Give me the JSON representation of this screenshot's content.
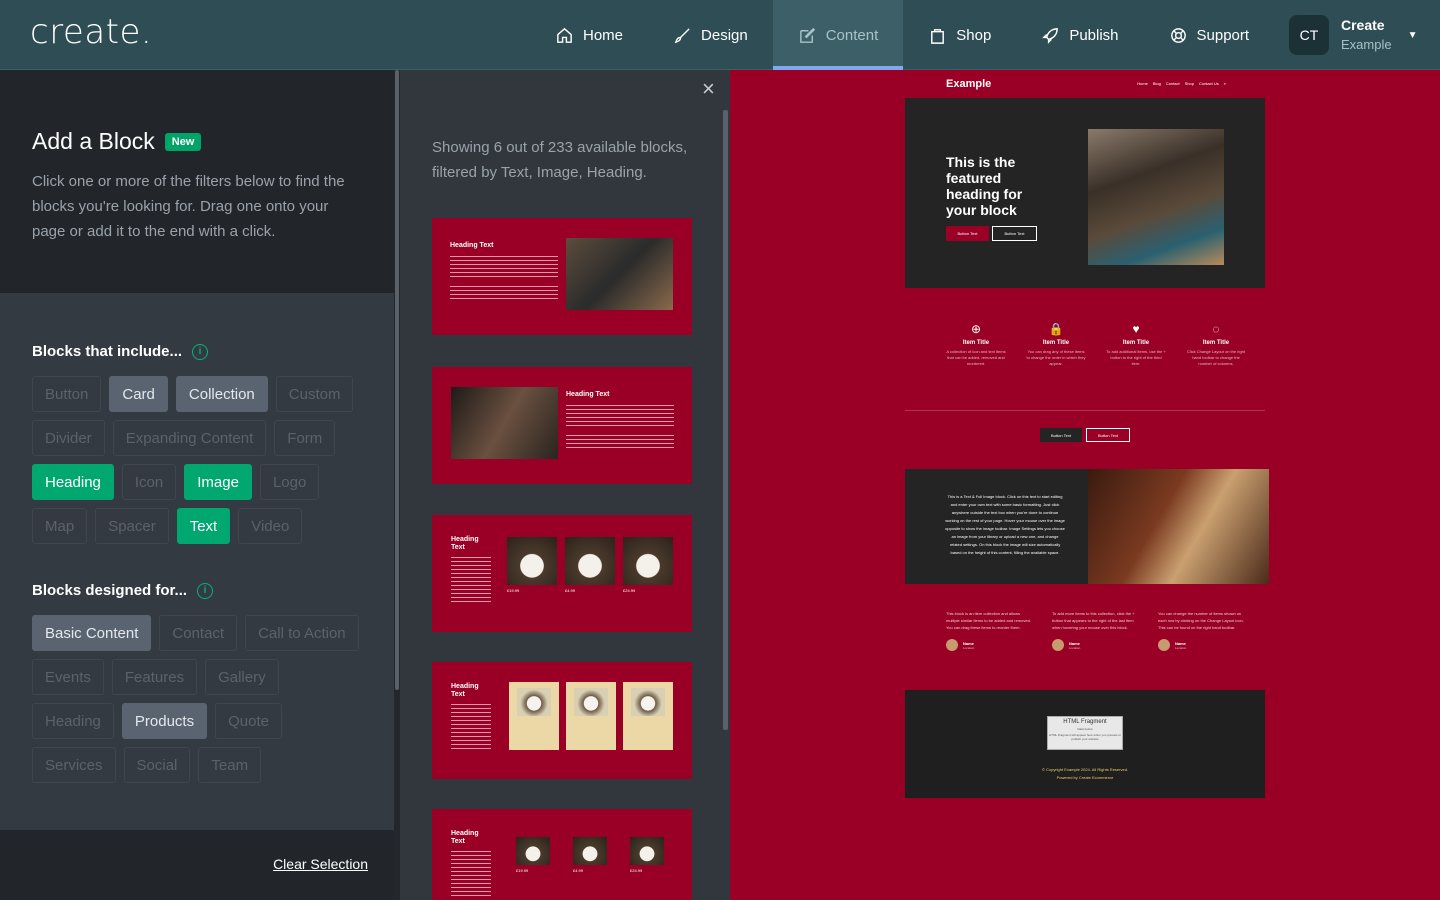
{
  "app": {
    "logo": "create."
  },
  "nav": [
    {
      "label": "Home",
      "icon": "home-icon"
    },
    {
      "label": "Design",
      "icon": "brush-icon"
    },
    {
      "label": "Content",
      "icon": "edit-icon",
      "active": true
    },
    {
      "label": "Shop",
      "icon": "shopping-bag-icon"
    },
    {
      "label": "Publish",
      "icon": "rocket-icon"
    },
    {
      "label": "Support",
      "icon": "lifebuoy-icon"
    }
  ],
  "user": {
    "initials": "CT",
    "name": "Create",
    "site": "Example"
  },
  "panel": {
    "title": "Add a Block",
    "badge": "New",
    "description": "Click one or more of the filters below to find the blocks you're looking for. Drag one onto your page or add it to the end with a click.",
    "include_title": "Blocks that include...",
    "include_chips": [
      {
        "label": "Button",
        "state": "disabled"
      },
      {
        "label": "Card",
        "state": "available"
      },
      {
        "label": "Collection",
        "state": "available"
      },
      {
        "label": "Custom",
        "state": "disabled"
      },
      {
        "label": "Divider",
        "state": "disabled"
      },
      {
        "label": "Expanding Content",
        "state": "disabled"
      },
      {
        "label": "Form",
        "state": "disabled"
      },
      {
        "label": "Heading",
        "state": "selected"
      },
      {
        "label": "Icon",
        "state": "disabled"
      },
      {
        "label": "Image",
        "state": "selected"
      },
      {
        "label": "Logo",
        "state": "disabled"
      },
      {
        "label": "Map",
        "state": "disabled"
      },
      {
        "label": "Spacer",
        "state": "disabled"
      },
      {
        "label": "Text",
        "state": "selected"
      },
      {
        "label": "Video",
        "state": "disabled"
      }
    ],
    "designed_title": "Blocks designed for...",
    "designed_chips": [
      {
        "label": "Basic Content",
        "state": "available"
      },
      {
        "label": "Contact",
        "state": "disabled"
      },
      {
        "label": "Call to Action",
        "state": "disabled"
      },
      {
        "label": "Events",
        "state": "disabled"
      },
      {
        "label": "Features",
        "state": "disabled"
      },
      {
        "label": "Gallery",
        "state": "disabled"
      },
      {
        "label": "Heading",
        "state": "disabled"
      },
      {
        "label": "Products",
        "state": "available"
      },
      {
        "label": "Quote",
        "state": "disabled"
      },
      {
        "label": "Services",
        "state": "disabled"
      },
      {
        "label": "Social",
        "state": "disabled"
      },
      {
        "label": "Team",
        "state": "disabled"
      }
    ],
    "clear_label": "Clear Selection"
  },
  "results": {
    "close_glyph": "×",
    "summary": "Showing 6 out of 233 available blocks, filtered by Text, Image, Heading.",
    "card_heading": "Heading Text",
    "card_heading_short": "Heading Text",
    "product_title": "Product Title",
    "prices": [
      "£19.99",
      "£4.99",
      "£24.99"
    ]
  },
  "preview": {
    "site_name": "Example",
    "links": [
      "Home",
      "Blog",
      "Contact",
      "Shop",
      "Contact Us"
    ],
    "hero_title": "This is the featured heading for your block",
    "button_text": "Button Text",
    "features": [
      {
        "icon": "zoom-icon",
        "glyph": "⊕",
        "title": "Item Title",
        "desc": "A collection of icon and text items that can be added, removed and reordered."
      },
      {
        "icon": "lock-icon",
        "glyph": "🔒",
        "title": "Item Title",
        "desc": "You can drag any of these items to change the order in which they appear."
      },
      {
        "icon": "heart-icon",
        "glyph": "♥",
        "title": "Item Title",
        "desc": "To add additional items, use the + button to the right of the third item."
      },
      {
        "icon": "spinner-icon",
        "glyph": "◌",
        "title": "Item Title",
        "desc": "Click Change Layout on the right hand toolbar to change the number of columns."
      }
    ],
    "tif_text": "This is a Text & Full Image block. Click on this text to start editing and enter your own text with some basic formatting. Just click anywhere outside the text box when you're done to continue working on the rest of your page. Hover your mouse over the image opposite to show the image toolbar. Image Settings lets you choose an image from your library or upload a new one, and change related settings. On this block the image will size automatically based on the height of this content, filling the available space.",
    "testimonials": [
      {
        "text": "This block is an item collection and allows multiple similar items to be added and removed. You can drag these items to reorder them.",
        "name": "Name",
        "location": "Location"
      },
      {
        "text": "To add more items to this collection, click the + button that appears to the right of the last item when hovering your mouse over this block.",
        "name": "Name",
        "location": "Location"
      },
      {
        "text": "You can change the number of items shown on each row by clicking on the Change Layout icon. This can be found on the right hand toolbar.",
        "name": "Name",
        "location": "Location"
      }
    ],
    "fragment_title": "HTML Fragment",
    "fragment_sub": "Data below",
    "fragment_note": "HTML Fragment will appear here when you preview or publish your website",
    "copyright": "© Copyright Example 2024. All Rights Reserved.",
    "powered": "Powered by Create Ecommerce"
  },
  "colors": {
    "accent": "#00a870",
    "brand": "#9a0025",
    "topbar": "#2e4d54"
  }
}
